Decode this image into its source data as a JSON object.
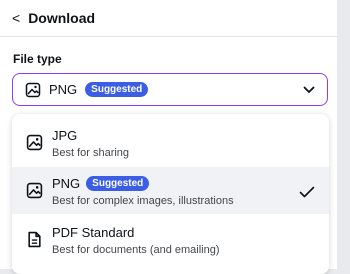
{
  "header": {
    "back_icon": "chevron-left-icon",
    "title": "Download"
  },
  "file_type": {
    "label": "File type",
    "selected": {
      "icon": "image-icon",
      "value": "PNG",
      "badge": "Suggested",
      "caret_icon": "chevron-down-icon"
    }
  },
  "options": [
    {
      "icon": "image-icon",
      "title": "JPG",
      "badge": "",
      "subtitle": "Best for sharing",
      "selected": false
    },
    {
      "icon": "image-icon",
      "title": "PNG",
      "badge": "Suggested",
      "subtitle": "Best for complex images, illustrations",
      "selected": true
    },
    {
      "icon": "document-icon",
      "title": "PDF Standard",
      "badge": "",
      "subtitle": "Best for documents (and emailing)",
      "selected": false
    }
  ],
  "colors": {
    "accent": "#8b3dff",
    "badge": "#3b5ee5",
    "selected_row": "#f1f2f5"
  }
}
